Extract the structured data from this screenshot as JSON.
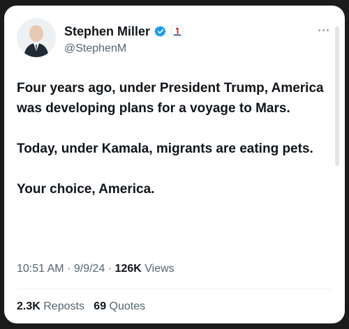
{
  "profile": {
    "display_name": "Stephen Miller",
    "handle": "@StephenM",
    "verified_icon": "verified-badge-icon",
    "affiliation_icon": "affiliation-badge-icon"
  },
  "tweet": {
    "paragraphs": [
      "Four years ago, under President Trump, America was developing plans for a voyage to Mars.",
      "Today, under Kamala, migrants are eating pets.",
      "Your choice, America."
    ],
    "time": "10:51 AM",
    "date": "9/9/24",
    "views_count": "126K",
    "views_label": "Views"
  },
  "stats": {
    "reposts_count": "2.3K",
    "reposts_label": "Reposts",
    "quotes_count": "69",
    "quotes_label": "Quotes"
  },
  "colors": {
    "text": "#0f1419",
    "secondary": "#536471",
    "verified_blue": "#1d9bf0",
    "background": "#ffffff",
    "outer": "#1b1b1b"
  }
}
